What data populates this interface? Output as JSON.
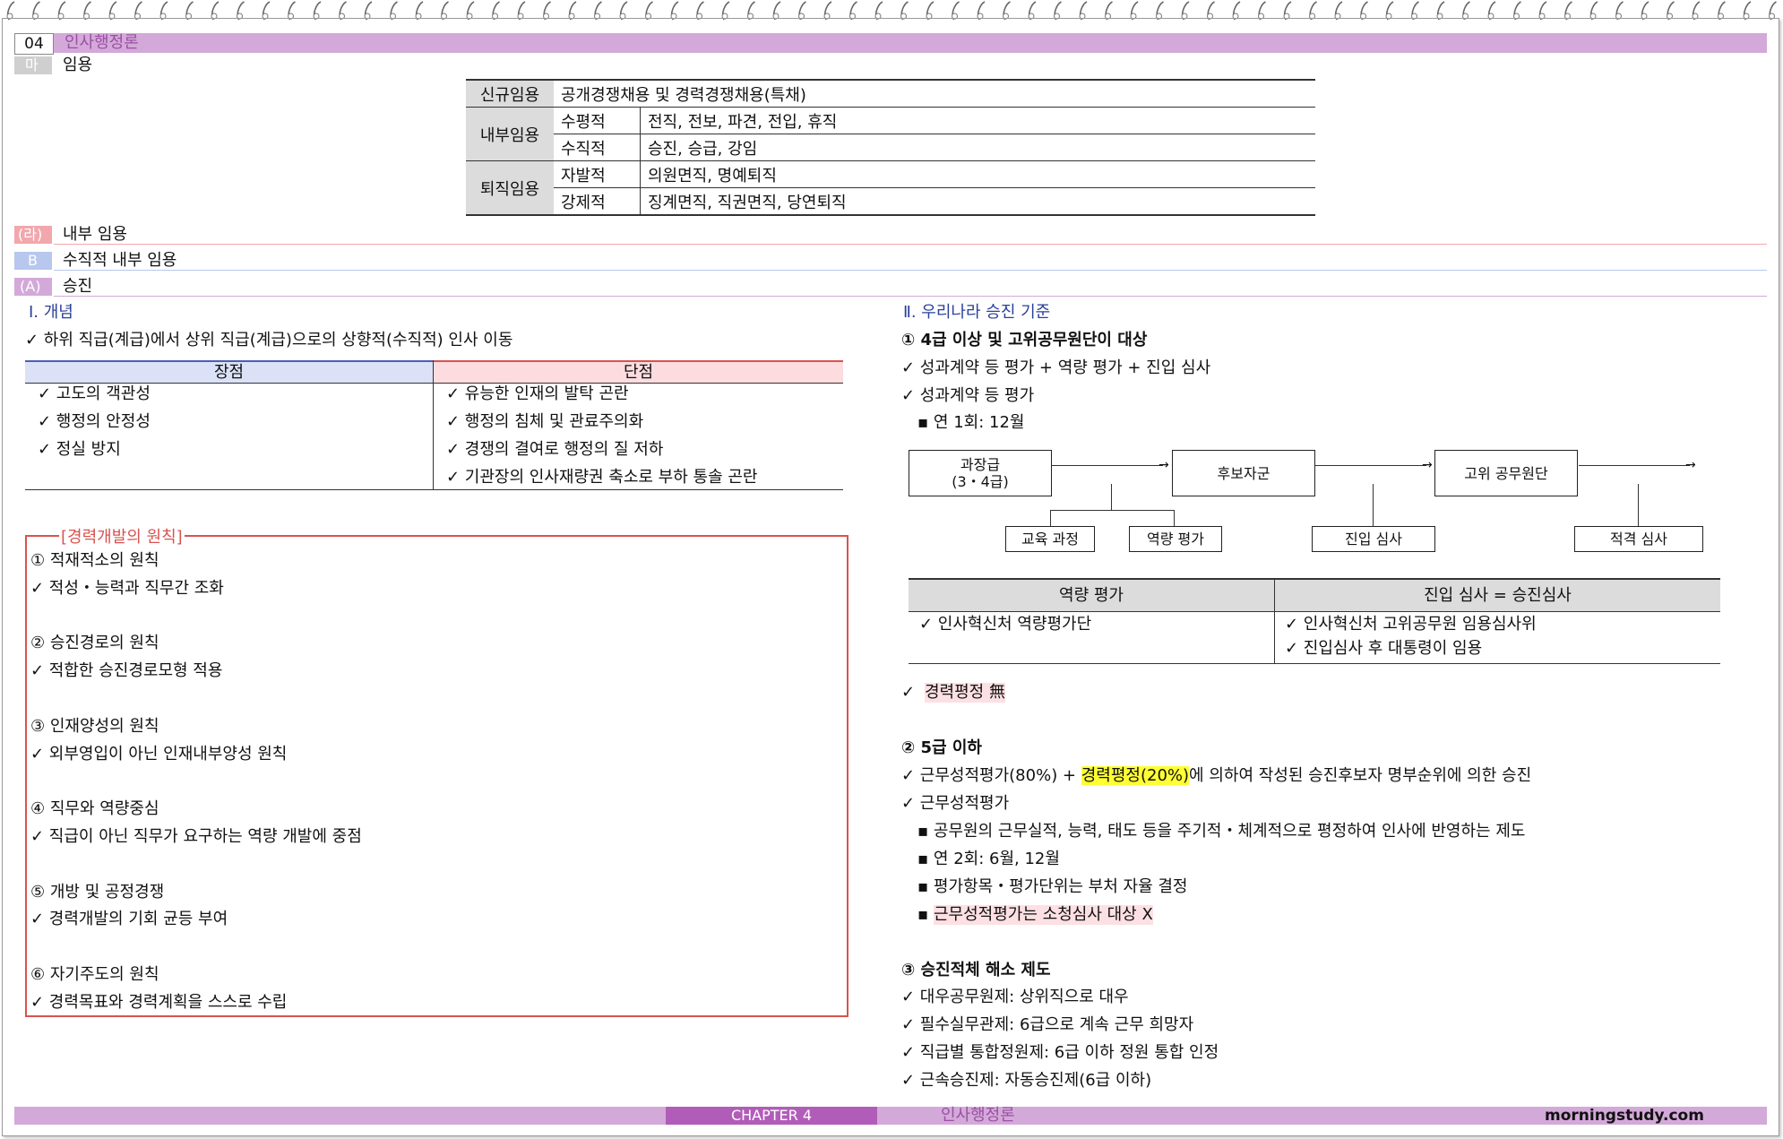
{
  "header": {
    "chapter_num": "04",
    "chapter_title": "인사행정론",
    "section_marker": "마",
    "section_title": "임용"
  },
  "appointment_table": {
    "rows": [
      {
        "category": "신규임용",
        "items": [
          {
            "type": "",
            "detail": "공개경쟁채용 및 경력경쟁채용(특채)"
          }
        ]
      },
      {
        "category": "내부임용",
        "items": [
          {
            "type": "수평적",
            "detail": "전직, 전보, 파견, 전입, 휴직"
          },
          {
            "type": "수직적",
            "detail": "승진, 승급, 강임"
          }
        ]
      },
      {
        "category": "퇴직임용",
        "items": [
          {
            "type": "자발적",
            "detail": "의원면직, 명예퇴직"
          },
          {
            "type": "강제적",
            "detail": "징계면직, 직권면직, 당연퇴직"
          }
        ]
      }
    ]
  },
  "subheads": [
    {
      "marker": "(라)",
      "title": "내부 임용",
      "color": "#f2a7ad"
    },
    {
      "marker": "B",
      "title": "수직적 내부 임용",
      "color": "#b7c7ee"
    },
    {
      "marker": "(A)",
      "title": "승진",
      "color": "#d3a9d9"
    }
  ],
  "left": {
    "concept_title": "Ⅰ. 개념",
    "concept_text": "✓ 하위 직급(계급)에서 상위 직급(계급)으로의 상향적(수직적) 인사 이동",
    "pros_header": "장점",
    "cons_header": "단점",
    "pros": [
      "✓ 고도의 객관성",
      "✓ 행정의 안정성",
      "✓ 정실 방지"
    ],
    "cons": [
      "✓ 유능한 인재의 발탁 곤란",
      "✓ 행정의 침체 및 관료주의화",
      "✓ 경쟁의 결여로 행정의 질 저하",
      "✓ 기관장의 인사재량권 축소로 부하 통솔 곤란"
    ],
    "career_box_title": "[경력개발의 원칙]",
    "career_lines": [
      "① 적재적소의 원칙",
      "✓ 적성・능력과 직무간 조화",
      "",
      "② 승진경로의 원칙",
      "✓ 적합한 승진경로모형 적용",
      "",
      "③ 인재양성의 원칙",
      "✓ 외부영입이 아닌 인재내부양성 원칙",
      "",
      "④ 직무와 역량중심",
      "✓ 직급이 아닌 직무가 요구하는 역량 개발에 중점",
      "",
      "⑤ 개방 및 공정경쟁",
      "✓ 경력개발의 기회 균등 부여",
      "",
      "⑥ 자기주도의 원칙",
      "✓ 경력목표와 경력계획을 스스로 수립"
    ]
  },
  "right": {
    "title": "Ⅱ. 우리나라 승진 기준",
    "s1_title": "① 4급 이상 및 고위공무원단이 대상",
    "s1_line1": "✓ 성과계약 등 평가 + 역량 평가 + 진입 심사",
    "s1_line2": "✓ 성과계약 등 평가",
    "s1_line3": "▪ 연 1회: 12월",
    "flow": {
      "box1": "과장급",
      "box1b": "(3・4급)",
      "box2": "후보자군",
      "box3": "고위 공무원단",
      "sub1": "교육 과정",
      "sub2": "역량 평가",
      "sub3": "진입 심사",
      "sub4": "적격 심사"
    },
    "eval_table": {
      "h1": "역량 평가",
      "h2": "진입 심사 = 승진심사",
      "c1": "✓ 인사혁신처 역량평가단",
      "c2a": "✓ 인사혁신처 고위공무원 임용심사위",
      "c2b": "✓ 진입심사 후 대통령이 임용"
    },
    "career_none_check": "✓",
    "career_none": "경력평정 無",
    "s2_title": "② 5급 이하",
    "s2_line1_a": "✓ 근무성적평가(80%) + ",
    "s2_line1_hl": "경력평정(20%)",
    "s2_line1_b": "에 의하여 작성된 승진후보자 명부순위에 의한 승진",
    "s2_line2": "✓ 근무성적평가",
    "s2_b1": "▪ 공무원의 근무실적, 능력, 태도 등을 주기적・체계적으로 평정하여 인사에 반영하는 제도",
    "s2_b2": "▪ 연 2회: 6월, 12월",
    "s2_b3": "▪ 평가항목・평가단위는 부처 자율 결정",
    "s2_b4_mark": "▪",
    "s2_b4": "근무성적평가는 소청심사 대상 X",
    "s3_title": "③ 승진적체 해소 제도",
    "s3_lines": [
      "✓ 대우공무원제: 상위직으로 대우",
      "✓ 필수실무관제: 6급으로 계속 근무 희망자",
      "✓ 직급별 통합정원제: 6급 이하 정원 통합 인정",
      "✓ 근속승진제: 자동승진제(6급 이하)"
    ]
  },
  "footer": {
    "chapter": "CHAPTER 4",
    "title": "인사행정론",
    "site": "morningstudy.com"
  },
  "colors": {
    "purple": "#d3a9d9",
    "dark_purple": "#b25cba",
    "pink_bar": "#f2a7ad",
    "blue_bar": "#b7c7ee",
    "table_head": "#dcdcdc",
    "box_red": "#d9534f"
  }
}
